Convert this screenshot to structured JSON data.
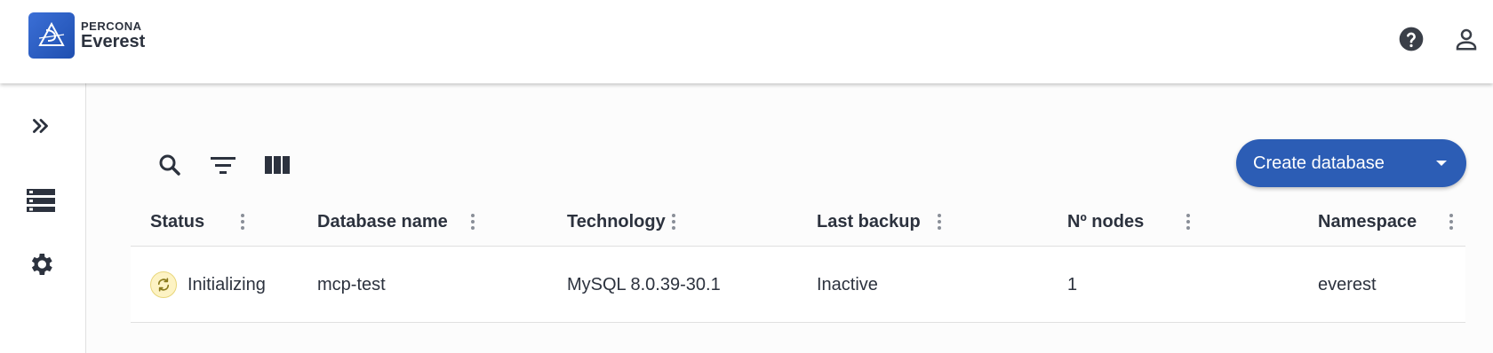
{
  "brand": {
    "company": "PERCONA",
    "product": "Everest"
  },
  "header": {
    "help_icon": "help-circle-icon",
    "user_icon": "account-icon"
  },
  "sidebar": {
    "items": [
      {
        "name": "expand",
        "icon": "double-chevron-right-icon"
      },
      {
        "name": "databases",
        "icon": "storage-list-icon"
      },
      {
        "name": "settings",
        "icon": "gear-icon"
      }
    ]
  },
  "toolbar": {
    "search_icon": "search-icon",
    "filter_icon": "filter-icon",
    "columns_icon": "view-columns-icon"
  },
  "create_button": {
    "label": "Create database"
  },
  "table": {
    "columns": [
      "Status",
      "Database name",
      "Technology",
      "Last backup",
      "Nº nodes",
      "Namespace"
    ],
    "rows": [
      {
        "status": "Initializing",
        "name": "mcp-test",
        "technology": "MySQL 8.0.39-30.1",
        "last_backup": "Inactive",
        "nodes": "1",
        "namespace": "everest"
      }
    ]
  },
  "colors": {
    "primary": "#2c5db5",
    "status_initializing_bg": "#fdf3c4",
    "text": "#2c323e"
  }
}
